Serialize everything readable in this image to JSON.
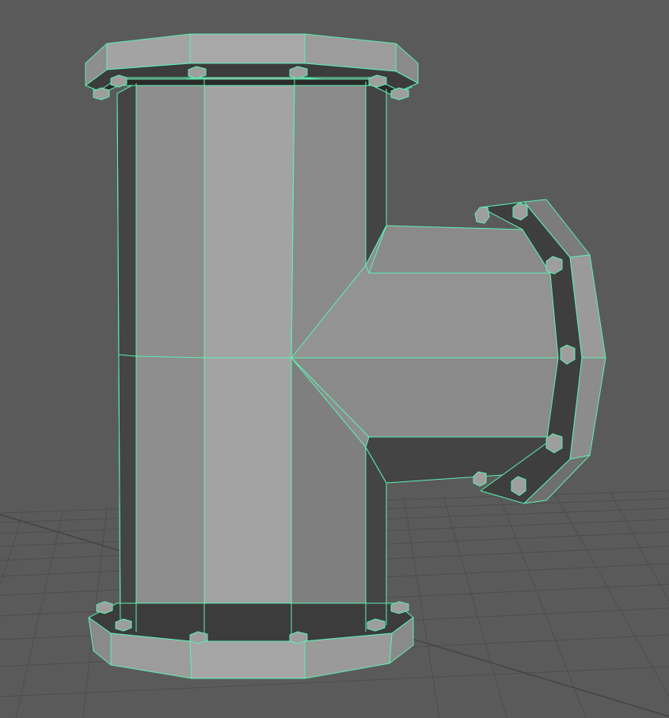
{
  "app": {
    "view": "perspective-viewport",
    "object": "pipe-tee-fitting",
    "shading": "flat-shaded-with-wireframe-on-shaded"
  },
  "colors": {
    "background": "#5a5a5a",
    "grid": "#4d4d4d",
    "grid_axis": "#3a3a3a",
    "wire": "#5cf0b2",
    "face_light": "#a3a3a3",
    "face_mid": "#8e8e8e",
    "face_dark": "#7a7a7a",
    "face_shadow": "#444444",
    "face_black": "#2a2a2a"
  },
  "icons": {
    "bolt": "hex-bolt-icon"
  }
}
